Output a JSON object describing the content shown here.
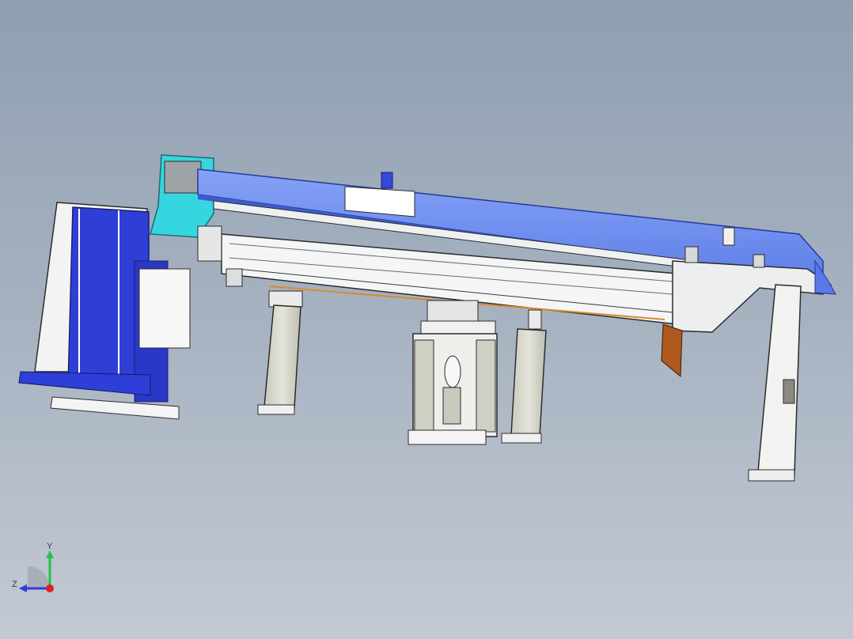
{
  "viewport": {
    "name": "3D model view",
    "colors": {
      "beam_blue": "#6f8ff0",
      "post_blue": "#2f3fd6",
      "cyan_bracket": "#35d6e0",
      "frame_white": "#eef0f2",
      "cylinder_gray": "#d4d4c8",
      "rust_plate": "#b0581d",
      "edge_dark": "#2c2c2c"
    }
  },
  "triad": {
    "y_label": "Y",
    "z_label": "Z",
    "y_color": "#22c24a",
    "z_color": "#2b3fe0",
    "x_color": "#e01e1e"
  }
}
